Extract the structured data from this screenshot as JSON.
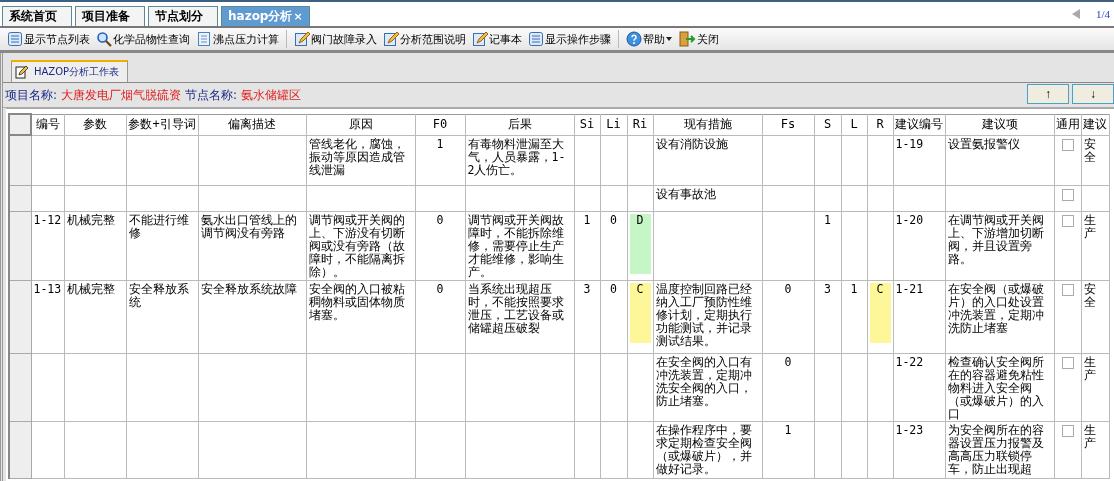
{
  "tabs": [
    {
      "label": "系统首页",
      "selected": false
    },
    {
      "label": "项目准备",
      "selected": false
    },
    {
      "label": "节点划分",
      "selected": false
    },
    {
      "label": "hazop分析",
      "selected": true,
      "close": "×"
    }
  ],
  "pager": {
    "page": "1/4"
  },
  "toolbar": [
    {
      "kind": "list",
      "label": "显示节点列表"
    },
    {
      "kind": "search",
      "label": "化学品物性查询"
    },
    {
      "kind": "doc",
      "label": "沸点压力计算"
    },
    {
      "kind": "separator"
    },
    {
      "kind": "edit",
      "label": "阀门故障录入"
    },
    {
      "kind": "edit",
      "label": "分析范围说明"
    },
    {
      "kind": "edit",
      "label": "记事本"
    },
    {
      "kind": "list",
      "label": "显示操作步骤"
    },
    {
      "kind": "separator"
    },
    {
      "kind": "help",
      "label": "帮助",
      "dropdown": true
    },
    {
      "kind": "exit",
      "label": "关闭"
    }
  ],
  "panel_tab": {
    "label": "HAZOP分析工作表"
  },
  "info": {
    "project_label": "项目名称:",
    "project": "大唐发电厂烟气脱硫资",
    "node_label": "节点名称:",
    "node": "氨水储罐区"
  },
  "nav_buttons": [
    "↑",
    "↓"
  ],
  "table": {
    "columns": [
      "编号",
      "参数",
      "参数+引导词",
      "偏离描述",
      "原因",
      "F0",
      "后果",
      "Si",
      "Li",
      "Ri",
      "现有措施",
      "Fs",
      "S",
      "L",
      "R",
      "建议编号",
      "建议项",
      "通用",
      "建议"
    ],
    "rows": [
      {
        "cells": [
          null,
          null,
          null,
          null,
          "管线老化，腐蚀，振动等原因造成管线泄漏",
          "1",
          "有毒物料泄漏至大气，人员暴露，1-2人伤亡。",
          null,
          null,
          null,
          "设有消防设施",
          null,
          null,
          null,
          null,
          "1-19",
          "设置氨报警仪",
          {
            "kind": "checkbox",
            "checked": false
          },
          "安全"
        ]
      },
      {
        "cells": [
          null,
          null,
          null,
          null,
          null,
          null,
          null,
          null,
          null,
          null,
          "设有事故池",
          null,
          null,
          null,
          null,
          null,
          null,
          {
            "kind": "checkbox",
            "checked": false
          },
          null
        ]
      },
      {
        "cells": [
          "1-12",
          "机械完整",
          "不能进行维修",
          "氨水出口管线上的调节阀没有旁路",
          "调节阀或开关阀的上、下游没有切断阀或没有旁路（故障时，不能隔离拆除）。",
          "0",
          "调节阀或开关阀故障时，不能拆除维修，需要停止生产才能维修，影响生产。",
          "1",
          "0",
          {
            "kind": "rating",
            "text": "D",
            "color": "#c6f5c6"
          },
          null,
          null,
          "1",
          null,
          null,
          "1-20",
          "在调节阀或开关阀上、下游增加切断阀，并且设置旁路。",
          {
            "kind": "checkbox",
            "checked": false
          },
          "生产"
        ]
      },
      {
        "cells": [
          "1-13",
          "机械完整",
          "安全释放系统",
          "安全释放系统故障",
          "安全阀的入口被粘稠物料或固体物质堵塞。",
          "0",
          "当系统出现超压时，不能按照要求泄压，工艺设备或储罐超压破裂",
          "3",
          "0",
          {
            "kind": "rating",
            "text": "C",
            "color": "#fdf79a"
          },
          "温度控制回路已经纳入工厂预防性维修计划，定期执行功能测试，并记录测试结果。",
          "0",
          "3",
          "1",
          {
            "kind": "rating",
            "text": "C",
            "color": "#fdf79a"
          },
          "1-21",
          "在安全阀（或爆破片）的入口处设置冲洗装置，定期冲洗防止堵塞",
          {
            "kind": "checkbox",
            "checked": false
          },
          "安全"
        ]
      },
      {
        "cells": [
          null,
          null,
          null,
          null,
          null,
          null,
          null,
          null,
          null,
          null,
          "在安全阀的入口有冲洗装置，定期冲洗安全阀的入口，防止堵塞。",
          "0",
          null,
          null,
          null,
          "1-22",
          "检查确认安全阀所在的容器避免粘性物料进入安全阀（或爆破片）的入口",
          {
            "kind": "checkbox",
            "checked": false
          },
          "生产"
        ]
      },
      {
        "cells": [
          null,
          null,
          null,
          null,
          null,
          null,
          null,
          null,
          null,
          null,
          "在操作程序中，要求定期检查安全阀（或爆破片），并做好记录。",
          "1",
          null,
          null,
          null,
          "1-23",
          "为安全阀所在的容器设置压力报警及高高压力联锁停车，防止出现超",
          {
            "kind": "checkbox",
            "checked": false
          },
          "生产"
        ]
      }
    ]
  }
}
